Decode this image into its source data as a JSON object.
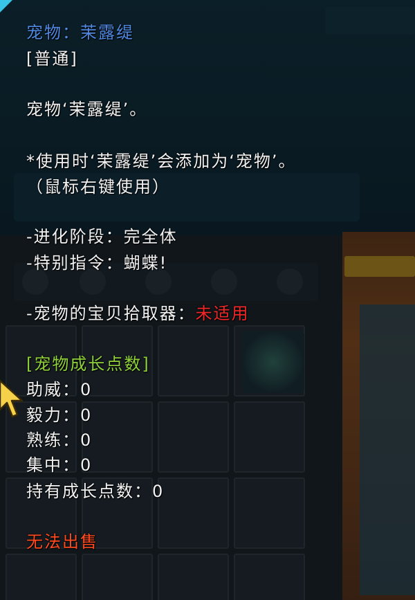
{
  "tooltip": {
    "title_label": "宠物：茉露缇",
    "grade": "[普通]",
    "description": "宠物‘茉露缇’。",
    "usage_line1": "*使用时‘茉露缇’会添加为‘宠物’。",
    "usage_line2": "（鼠标右键使用）",
    "evolution_stage": "-进化阶段：完全体",
    "special_command": "-特别指令：蝴蝶!",
    "pickup_label": "-宠物的宝贝拾取器：",
    "pickup_value": "未适用",
    "growth_header": "[宠物成长点数]",
    "stats": [
      {
        "label": "助威：",
        "value": "0"
      },
      {
        "label": "毅力：",
        "value": "0"
      },
      {
        "label": "熟练：",
        "value": "0"
      },
      {
        "label": "集中：",
        "value": "0"
      },
      {
        "label": "持有成长点数：",
        "value": "0"
      }
    ],
    "sell_status": "无法出售"
  },
  "colors": {
    "title": "#4f88e2",
    "growth_header": "#8fd13a",
    "warning": "#ee2828",
    "text": "#f2f2f2"
  },
  "icons": [
    "cursor-arrow-icon",
    "pet-item-icon"
  ]
}
